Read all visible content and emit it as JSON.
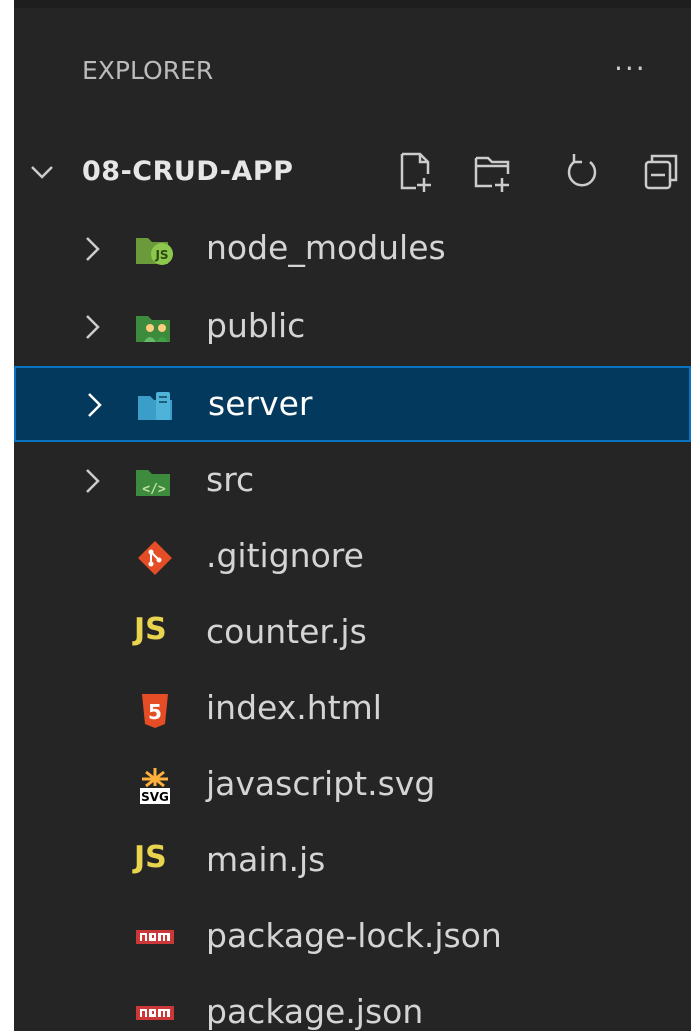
{
  "explorer": {
    "title": "EXPLORER",
    "more_actions": "···"
  },
  "root": {
    "name": "08-CRUD-APP",
    "toolbar_icons": [
      "new-file-icon",
      "new-folder-icon",
      "refresh-icon",
      "collapse-all-icon"
    ]
  },
  "tree": [
    {
      "name": "node_modules",
      "type": "folder",
      "icon": "node-modules-folder-icon",
      "color": "#8cc84b"
    },
    {
      "name": "public",
      "type": "folder",
      "icon": "public-folder-icon",
      "color": "#4caf50"
    },
    {
      "name": "server",
      "type": "folder",
      "icon": "server-folder-icon",
      "color": "#4fb3d9",
      "selected": true
    },
    {
      "name": "src",
      "type": "folder",
      "icon": "src-folder-icon",
      "color": "#4caf50"
    },
    {
      "name": ".gitignore",
      "type": "file",
      "icon": "git-icon",
      "color": "#e44d26"
    },
    {
      "name": "counter.js",
      "type": "file",
      "icon": "javascript-icon",
      "icon_text": "JS",
      "color": "#e8d44d"
    },
    {
      "name": "index.html",
      "type": "file",
      "icon": "html5-icon",
      "color": "#e44d26"
    },
    {
      "name": "javascript.svg",
      "type": "file",
      "icon": "svg-icon",
      "color": "#ffb13b"
    },
    {
      "name": "main.js",
      "type": "file",
      "icon": "javascript-icon",
      "icon_text": "JS",
      "color": "#e8d44d"
    },
    {
      "name": "package-lock.json",
      "type": "file",
      "icon": "npm-icon",
      "color": "#cb3837"
    },
    {
      "name": "package.json",
      "type": "file",
      "icon": "npm-icon",
      "color": "#cb3837"
    }
  ]
}
